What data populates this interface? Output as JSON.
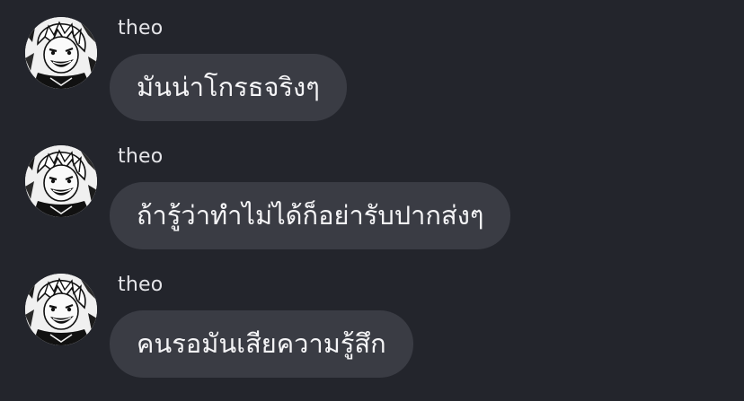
{
  "colors": {
    "background": "#23252c",
    "bubble": "#3a3c44",
    "sender_text": "#e4e4e8",
    "message_text": "#f4f4f6"
  },
  "messages": [
    {
      "sender": "theo",
      "avatar_icon": "manga-character-avatar",
      "text": "มันน่าโกรธจริงๆ"
    },
    {
      "sender": "theo",
      "avatar_icon": "manga-character-avatar",
      "text": "ถ้ารู้ว่าทำไม่ได้ก็อย่ารับปากส่งๆ"
    },
    {
      "sender": "theo",
      "avatar_icon": "manga-character-avatar",
      "text": "คนรอมันเสียความรู้สึก"
    }
  ]
}
